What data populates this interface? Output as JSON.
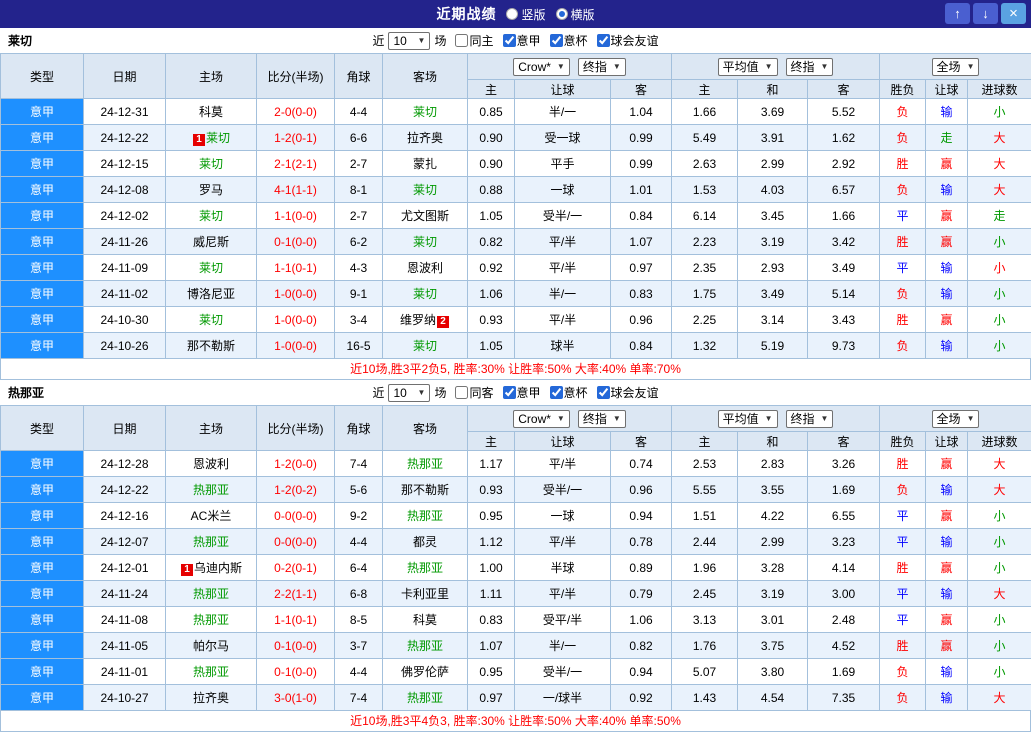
{
  "topbar": {
    "title": "近期战绩",
    "vertical": "竖版",
    "horizontal": "横版",
    "vertical_selected": false,
    "horizontal_selected": true,
    "up": "↑",
    "down": "↓",
    "close": "×"
  },
  "filter": {
    "near": "近",
    "count": "10",
    "matches": "场",
    "league": "意甲",
    "cup": "意杯",
    "friendly": "球会友谊",
    "same_checked": false,
    "league_checked": true,
    "cup_checked": true,
    "friendly_checked": true
  },
  "headers": {
    "type": "类型",
    "date": "日期",
    "home": "主场",
    "score": "比分(半场)",
    "corner": "角球",
    "away": "客场",
    "ah_select1": "Crow*",
    "ah_select2": "终指",
    "ah_home": "主",
    "ah_line": "让球",
    "ah_away": "客",
    "eu_select1": "平均值",
    "eu_select2": "终指",
    "eu_home": "主",
    "eu_draw": "和",
    "eu_away": "客",
    "scope_select": "全场",
    "result": "胜负",
    "line_result": "让球",
    "goals": "进球数"
  },
  "sections": [
    {
      "team": "莱切",
      "same_label": "同主",
      "summary": "近10场,胜3平2负5, 胜率:30% 让胜率:50% 大率:40% 单率:70%",
      "rows": [
        {
          "league": "意甲",
          "date": "24-12-31",
          "home": {
            "name": "科莫"
          },
          "score": "2-0(0-0)",
          "corner": "4-4",
          "away": {
            "name": "莱切",
            "self": true
          },
          "ah": [
            "0.85",
            "半/一",
            "1.04"
          ],
          "eu": [
            "1.66",
            "3.69",
            "5.52"
          ],
          "res": [
            {
              "t": "负",
              "c": "red"
            },
            {
              "t": "输",
              "c": "blue"
            },
            {
              "t": "小",
              "c": "green"
            }
          ]
        },
        {
          "league": "意甲",
          "date": "24-12-22",
          "home": {
            "name": "莱切",
            "self": true,
            "badge": "1"
          },
          "score": "1-2(0-1)",
          "corner": "6-6",
          "away": {
            "name": "拉齐奥"
          },
          "ah": [
            "0.90",
            "受一球",
            "0.99"
          ],
          "eu": [
            "5.49",
            "3.91",
            "1.62"
          ],
          "res": [
            {
              "t": "负",
              "c": "red"
            },
            {
              "t": "走",
              "c": "green"
            },
            {
              "t": "大",
              "c": "red"
            }
          ]
        },
        {
          "league": "意甲",
          "date": "24-12-15",
          "home": {
            "name": "莱切",
            "self": true
          },
          "score": "2-1(2-1)",
          "corner": "2-7",
          "away": {
            "name": "蒙扎"
          },
          "ah": [
            "0.90",
            "平手",
            "0.99"
          ],
          "eu": [
            "2.63",
            "2.99",
            "2.92"
          ],
          "res": [
            {
              "t": "胜",
              "c": "red"
            },
            {
              "t": "赢",
              "c": "red"
            },
            {
              "t": "大",
              "c": "red"
            }
          ]
        },
        {
          "league": "意甲",
          "date": "24-12-08",
          "home": {
            "name": "罗马"
          },
          "score": "4-1(1-1)",
          "corner": "8-1",
          "away": {
            "name": "莱切",
            "self": true
          },
          "ah": [
            "0.88",
            "一球",
            "1.01"
          ],
          "eu": [
            "1.53",
            "4.03",
            "6.57"
          ],
          "res": [
            {
              "t": "负",
              "c": "red"
            },
            {
              "t": "输",
              "c": "blue"
            },
            {
              "t": "大",
              "c": "red"
            }
          ]
        },
        {
          "league": "意甲",
          "date": "24-12-02",
          "home": {
            "name": "莱切",
            "self": true
          },
          "score": "1-1(0-0)",
          "corner": "2-7",
          "away": {
            "name": "尤文图斯"
          },
          "ah": [
            "1.05",
            "受半/一",
            "0.84"
          ],
          "eu": [
            "6.14",
            "3.45",
            "1.66"
          ],
          "res": [
            {
              "t": "平",
              "c": "blue"
            },
            {
              "t": "赢",
              "c": "red"
            },
            {
              "t": "走",
              "c": "green"
            }
          ]
        },
        {
          "league": "意甲",
          "date": "24-11-26",
          "home": {
            "name": "威尼斯"
          },
          "score": "0-1(0-0)",
          "corner": "6-2",
          "away": {
            "name": "莱切",
            "self": true
          },
          "ah": [
            "0.82",
            "平/半",
            "1.07"
          ],
          "eu": [
            "2.23",
            "3.19",
            "3.42"
          ],
          "res": [
            {
              "t": "胜",
              "c": "red"
            },
            {
              "t": "赢",
              "c": "red"
            },
            {
              "t": "小",
              "c": "green"
            }
          ]
        },
        {
          "league": "意甲",
          "date": "24-11-09",
          "home": {
            "name": "莱切",
            "self": true
          },
          "score": "1-1(0-1)",
          "corner": "4-3",
          "away": {
            "name": "恩波利"
          },
          "ah": [
            "0.92",
            "平/半",
            "0.97"
          ],
          "eu": [
            "2.35",
            "2.93",
            "3.49"
          ],
          "res": [
            {
              "t": "平",
              "c": "blue"
            },
            {
              "t": "输",
              "c": "blue"
            },
            {
              "t": "小",
              "c": "red"
            }
          ]
        },
        {
          "league": "意甲",
          "date": "24-11-02",
          "home": {
            "name": "博洛尼亚"
          },
          "score": "1-0(0-0)",
          "corner": "9-1",
          "away": {
            "name": "莱切",
            "self": true
          },
          "ah": [
            "1.06",
            "半/一",
            "0.83"
          ],
          "eu": [
            "1.75",
            "3.49",
            "5.14"
          ],
          "res": [
            {
              "t": "负",
              "c": "red"
            },
            {
              "t": "输",
              "c": "blue"
            },
            {
              "t": "小",
              "c": "green"
            }
          ]
        },
        {
          "league": "意甲",
          "date": "24-10-30",
          "home": {
            "name": "莱切",
            "self": true
          },
          "score": "1-0(0-0)",
          "corner": "3-4",
          "away": {
            "name": "维罗纳",
            "badgeAfter": "2"
          },
          "ah": [
            "0.93",
            "平/半",
            "0.96"
          ],
          "eu": [
            "2.25",
            "3.14",
            "3.43"
          ],
          "res": [
            {
              "t": "胜",
              "c": "red"
            },
            {
              "t": "赢",
              "c": "red"
            },
            {
              "t": "小",
              "c": "green"
            }
          ]
        },
        {
          "league": "意甲",
          "date": "24-10-26",
          "home": {
            "name": "那不勒斯"
          },
          "score": "1-0(0-0)",
          "corner": "16-5",
          "away": {
            "name": "莱切",
            "self": true
          },
          "ah": [
            "1.05",
            "球半",
            "0.84"
          ],
          "eu": [
            "1.32",
            "5.19",
            "9.73"
          ],
          "res": [
            {
              "t": "负",
              "c": "red"
            },
            {
              "t": "输",
              "c": "blue"
            },
            {
              "t": "小",
              "c": "green"
            }
          ]
        }
      ]
    },
    {
      "team": "热那亚",
      "same_label": "同客",
      "summary": "近10场,胜3平4负3, 胜率:30% 让胜率:50% 大率:40% 单率:50%",
      "rows": [
        {
          "league": "意甲",
          "date": "24-12-28",
          "home": {
            "name": "恩波利"
          },
          "score": "1-2(0-0)",
          "corner": "7-4",
          "away": {
            "name": "热那亚",
            "self": true
          },
          "ah": [
            "1.17",
            "平/半",
            "0.74"
          ],
          "eu": [
            "2.53",
            "2.83",
            "3.26"
          ],
          "res": [
            {
              "t": "胜",
              "c": "red"
            },
            {
              "t": "赢",
              "c": "red"
            },
            {
              "t": "大",
              "c": "red"
            }
          ]
        },
        {
          "league": "意甲",
          "date": "24-12-22",
          "home": {
            "name": "热那亚",
            "self": true
          },
          "score": "1-2(0-2)",
          "corner": "5-6",
          "away": {
            "name": "那不勒斯"
          },
          "ah": [
            "0.93",
            "受半/一",
            "0.96"
          ],
          "eu": [
            "5.55",
            "3.55",
            "1.69"
          ],
          "res": [
            {
              "t": "负",
              "c": "red"
            },
            {
              "t": "输",
              "c": "blue"
            },
            {
              "t": "大",
              "c": "red"
            }
          ]
        },
        {
          "league": "意甲",
          "date": "24-12-16",
          "home": {
            "name": "AC米兰"
          },
          "score": "0-0(0-0)",
          "corner": "9-2",
          "away": {
            "name": "热那亚",
            "self": true
          },
          "ah": [
            "0.95",
            "一球",
            "0.94"
          ],
          "eu": [
            "1.51",
            "4.22",
            "6.55"
          ],
          "res": [
            {
              "t": "平",
              "c": "blue"
            },
            {
              "t": "赢",
              "c": "red"
            },
            {
              "t": "小",
              "c": "green"
            }
          ]
        },
        {
          "league": "意甲",
          "date": "24-12-07",
          "home": {
            "name": "热那亚",
            "self": true
          },
          "score": "0-0(0-0)",
          "corner": "4-4",
          "away": {
            "name": "都灵"
          },
          "ah": [
            "1.12",
            "平/半",
            "0.78"
          ],
          "eu": [
            "2.44",
            "2.99",
            "3.23"
          ],
          "res": [
            {
              "t": "平",
              "c": "blue"
            },
            {
              "t": "输",
              "c": "blue"
            },
            {
              "t": "小",
              "c": "green"
            }
          ]
        },
        {
          "league": "意甲",
          "date": "24-12-01",
          "home": {
            "name": "乌迪内斯",
            "badge": "1"
          },
          "score": "0-2(0-1)",
          "corner": "6-4",
          "away": {
            "name": "热那亚",
            "self": true
          },
          "ah": [
            "1.00",
            "半球",
            "0.89"
          ],
          "eu": [
            "1.96",
            "3.28",
            "4.14"
          ],
          "res": [
            {
              "t": "胜",
              "c": "red"
            },
            {
              "t": "赢",
              "c": "red"
            },
            {
              "t": "小",
              "c": "green"
            }
          ]
        },
        {
          "league": "意甲",
          "date": "24-11-24",
          "home": {
            "name": "热那亚",
            "self": true
          },
          "score": "2-2(1-1)",
          "corner": "6-8",
          "away": {
            "name": "卡利亚里"
          },
          "ah": [
            "1.11",
            "平/半",
            "0.79"
          ],
          "eu": [
            "2.45",
            "3.19",
            "3.00"
          ],
          "res": [
            {
              "t": "平",
              "c": "blue"
            },
            {
              "t": "输",
              "c": "blue"
            },
            {
              "t": "大",
              "c": "red"
            }
          ]
        },
        {
          "league": "意甲",
          "date": "24-11-08",
          "home": {
            "name": "热那亚",
            "self": true
          },
          "score": "1-1(0-1)",
          "corner": "8-5",
          "away": {
            "name": "科莫"
          },
          "ah": [
            "0.83",
            "受平/半",
            "1.06"
          ],
          "eu": [
            "3.13",
            "3.01",
            "2.48"
          ],
          "res": [
            {
              "t": "平",
              "c": "blue"
            },
            {
              "t": "赢",
              "c": "red"
            },
            {
              "t": "小",
              "c": "green"
            }
          ]
        },
        {
          "league": "意甲",
          "date": "24-11-05",
          "home": {
            "name": "帕尔马"
          },
          "score": "0-1(0-0)",
          "corner": "3-7",
          "away": {
            "name": "热那亚",
            "self": true
          },
          "ah": [
            "1.07",
            "半/一",
            "0.82"
          ],
          "eu": [
            "1.76",
            "3.75",
            "4.52"
          ],
          "res": [
            {
              "t": "胜",
              "c": "red"
            },
            {
              "t": "赢",
              "c": "red"
            },
            {
              "t": "小",
              "c": "green"
            }
          ]
        },
        {
          "league": "意甲",
          "date": "24-11-01",
          "home": {
            "name": "热那亚",
            "self": true
          },
          "score": "0-1(0-0)",
          "corner": "4-4",
          "away": {
            "name": "佛罗伦萨"
          },
          "ah": [
            "0.95",
            "受半/一",
            "0.94"
          ],
          "eu": [
            "5.07",
            "3.80",
            "1.69"
          ],
          "res": [
            {
              "t": "负",
              "c": "red"
            },
            {
              "t": "输",
              "c": "blue"
            },
            {
              "t": "小",
              "c": "green"
            }
          ]
        },
        {
          "league": "意甲",
          "date": "24-10-27",
          "home": {
            "name": "拉齐奥"
          },
          "score": "3-0(1-0)",
          "corner": "7-4",
          "away": {
            "name": "热那亚",
            "self": true
          },
          "ah": [
            "0.97",
            "一/球半",
            "0.92"
          ],
          "eu": [
            "1.43",
            "4.54",
            "7.35"
          ],
          "res": [
            {
              "t": "负",
              "c": "red"
            },
            {
              "t": "输",
              "c": "blue"
            },
            {
              "t": "大",
              "c": "red"
            }
          ]
        }
      ]
    }
  ],
  "colors": {
    "topbar_bg": "#23238c",
    "league_cell_bg": "#1e90ff",
    "header_bg": "#dce7f3",
    "stripe_bg": "#e9f2fc",
    "win_red": "#ff0000",
    "lose_blue": "#0000ff",
    "push_green": "#009900",
    "self_team_green": "#009900"
  }
}
